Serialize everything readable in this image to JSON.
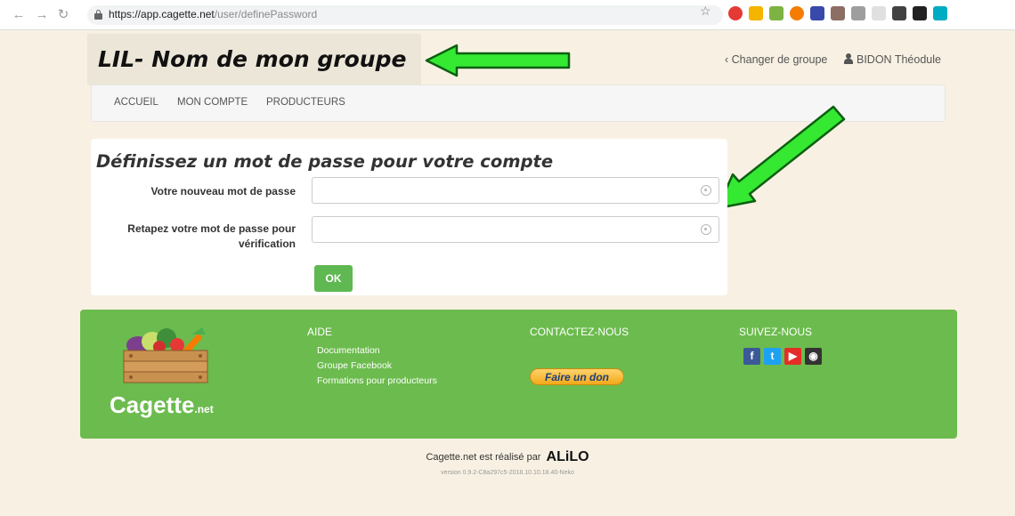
{
  "browser": {
    "url_host": "https://app.cagette.net",
    "url_path": "/user/definePassword"
  },
  "header": {
    "group_name": "LIL- Nom de mon groupe",
    "change_group": "Changer de groupe",
    "user_name": "BIDON Théodule"
  },
  "nav": {
    "items": [
      "ACCUEIL",
      "MON COMPTE",
      "PRODUCTEURS"
    ]
  },
  "form": {
    "title": "Définissez un mot de passe pour votre compte",
    "new_password_label": "Votre nouveau mot de passe",
    "retype_label_line1": "Retapez votre mot de passe pour",
    "retype_label_line2": "vérification",
    "new_password_value": "",
    "retype_value": "",
    "submit": "OK"
  },
  "footer": {
    "brand": "Cagette",
    "brand_tld": ".net",
    "help_title": "AIDE",
    "help_links": [
      "Documentation",
      "Groupe Facebook",
      "Formations pour producteurs"
    ],
    "contact_title": "CONTACTEZ-NOUS",
    "donate": "Faire un don",
    "follow_title": "SUIVEZ-NOUS",
    "social": [
      {
        "name": "facebook-icon",
        "glyph": "f",
        "color": "#3b5998"
      },
      {
        "name": "twitter-icon",
        "glyph": "t",
        "color": "#1da1f2"
      },
      {
        "name": "youtube-icon",
        "glyph": "▶",
        "color": "#e52d27"
      },
      {
        "name": "github-icon",
        "glyph": "◉",
        "color": "#333333"
      }
    ]
  },
  "credit": {
    "text": "Cagette.net est réalisé par",
    "company": "ALiLO",
    "version": "version 0.9.2-C8a297c5-2018.10.10.18.40-Neko"
  },
  "colors": {
    "accent_green": "#5fb851",
    "footer_green": "#6cbb4e",
    "arrow_green": "#35e832",
    "background": "#f8f1e3"
  }
}
